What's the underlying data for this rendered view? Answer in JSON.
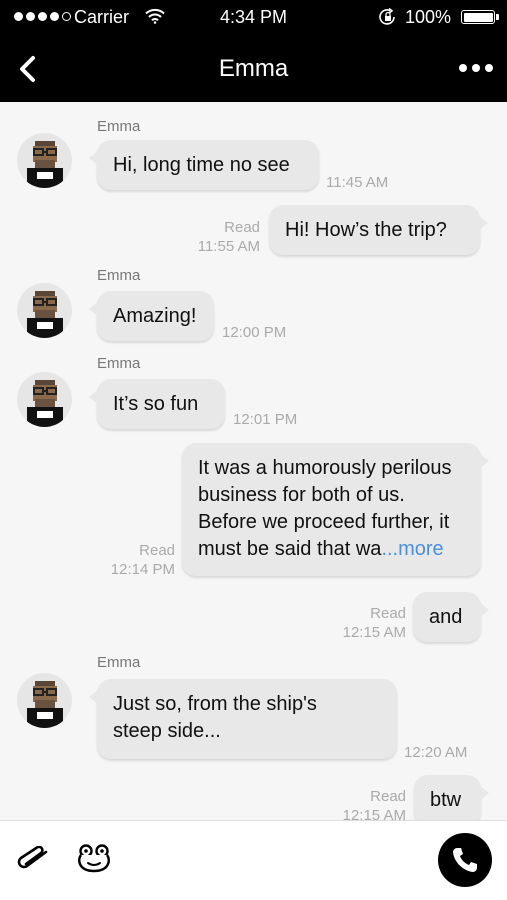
{
  "status_bar": {
    "carrier": "Carrier",
    "time": "4:34 PM",
    "battery": "100%",
    "signal_icon": "signal-dots-icon",
    "wifi_icon": "wifi-icon",
    "lock_icon": "rotation-lock-icon",
    "battery_icon": "battery-icon"
  },
  "header": {
    "title": "Emma",
    "back_icon": "chevron-left-icon",
    "more_icon": "more-dots-icon"
  },
  "messages": [
    {
      "direction": "in",
      "sender": "Emma",
      "text": "Hi, long time no see",
      "time": "11:45 AM"
    },
    {
      "direction": "out",
      "status": "Read",
      "text": "Hi! How’s the trip?",
      "time": "11:55 AM"
    },
    {
      "direction": "in",
      "sender": "Emma",
      "text": "Amazing!",
      "time": "12:00 PM"
    },
    {
      "direction": "in",
      "sender": "Emma",
      "text": "It’s so fun",
      "time": "12:01 PM"
    },
    {
      "direction": "out",
      "status": "Read",
      "text_lines": [
        "It was a humorously perilous",
        "business for both of us.",
        "Before we proceed further, it",
        "must be said that wa"
      ],
      "more_label": "...more",
      "time": "12:14 PM"
    },
    {
      "direction": "out",
      "status": "Read",
      "text": "and",
      "time": "12:15 AM"
    },
    {
      "direction": "in",
      "sender": "Emma",
      "text_lines": [
        "Just so, from the ship's",
        "steep side..."
      ],
      "time": "12:20 AM"
    },
    {
      "direction": "out",
      "status": "Read",
      "text": "btw",
      "time": "12:15 AM"
    }
  ],
  "input_bar": {
    "attach_icon": "paperclip-icon",
    "sticker_icon": "frog-sticker-icon",
    "call_icon": "phone-icon"
  },
  "colors": {
    "bar_background": "#000000",
    "chat_background": "#f6f6f6",
    "bubble": "#e8e8e8",
    "link": "#4a90d9"
  }
}
